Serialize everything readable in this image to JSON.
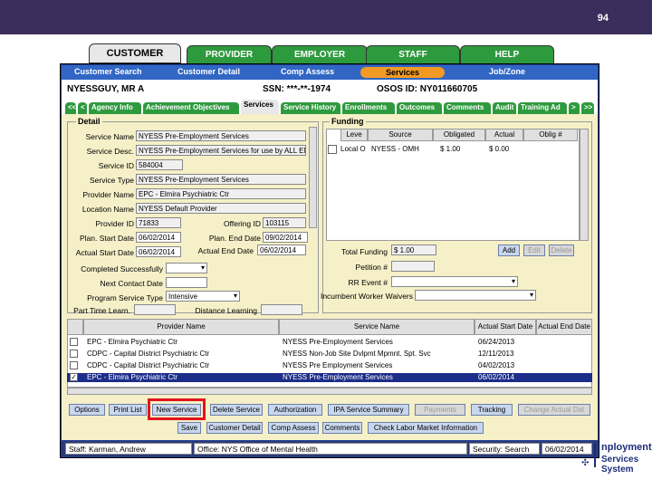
{
  "slide_number": "94",
  "main_tabs": [
    "CUSTOMER",
    "PROVIDER",
    "EMPLOYER",
    "STAFF",
    "HELP"
  ],
  "sub_nav": [
    "Customer Search",
    "Customer Detail",
    "Comp Assess",
    "Services",
    "Job/Zone"
  ],
  "customer": {
    "name": "NYESSGUY, MR  A",
    "ssn": "SSN: ***-**-1974",
    "osos_id": "OSOS ID: NY011660705"
  },
  "content_tabs": [
    "<<",
    "< ",
    "Agency Info",
    "Achievement Objectives",
    "Services",
    "Service History",
    "Enrollments",
    "Outcomes",
    "Comments",
    "Audit",
    "Training Ad",
    ">",
    ">>"
  ],
  "detail": {
    "section_title": "Detail",
    "labels": {
      "service_name": "Service Name",
      "service_desc": "Service Desc.",
      "service_id": "Service ID",
      "service_type": "Service Type",
      "provider_name": "Provider Name",
      "location_name": "Location Name",
      "provider_id": "Provider ID",
      "offering_id": "Offering ID",
      "plan_start": "Plan. Start Date",
      "plan_end": "Plan. End Date",
      "actual_start": "Actual Start Date",
      "actual_end": "Actual End Date",
      "completed": "Completed Successfully",
      "next_contact": "Next Contact Date",
      "program_type": "Program Service Type",
      "part_time": "Part Time Learn.",
      "distance": "Distance Learning"
    },
    "values": {
      "service_name": "NYESS Pre-Employment Services",
      "service_desc": "NYESS Pre-Employment Services for use by ALL EN",
      "service_id": "584004",
      "service_type": "NYESS Pre-Employment Services",
      "provider_name": "EPC - Elmira Psychiatric Ctr",
      "location_name": "NYESS Default Provider",
      "provider_id": "71833",
      "offering_id": "103115",
      "plan_start": "06/02/2014",
      "plan_end": "09/02/2014",
      "actual_start": "06/02/2014",
      "actual_end": "06/02/2014",
      "program_type": "Intensive"
    }
  },
  "funding": {
    "section_title": "Funding",
    "headers": [
      "Leve",
      "Source",
      "Obligated",
      "Actual",
      "Oblig #"
    ],
    "row": [
      "Local O",
      "NYESS - OMH",
      "$ 1.00",
      "$ 0.00",
      ""
    ],
    "labels": {
      "total": "Total Funding",
      "petition": "Petition #",
      "rr_event": "RR Event #",
      "incumbent": "Incumbent Worker Waivers"
    },
    "total_value": "$ 1.00",
    "buttons": [
      "Add",
      "Edit",
      "Delete"
    ]
  },
  "grid": {
    "headers": [
      "Provider Name",
      "Service Name",
      "Actual Start Date",
      "Actual End Date"
    ],
    "rows": [
      {
        "provider": "EPC - Elmira Psychiatric Ctr",
        "service": "NYESS Pre-Employment Services",
        "start": "06/24/2013",
        "end": "",
        "checked": true,
        "selected": false
      },
      {
        "provider": "CDPC - Capital District Psychiatric Ctr",
        "service": "NYESS Non-Job Site Dvlpmt Mpmnt. Spt. Svc",
        "start": "12/11/2013",
        "end": "",
        "checked": false,
        "selected": false
      },
      {
        "provider": "CDPC - Capital District Psychiatric Ctr",
        "service": "NYESS Pre Employment Services",
        "start": "04/02/2013",
        "end": "",
        "checked": false,
        "selected": false
      },
      {
        "provider": "EPC - Elmira Psychiatric Ctr",
        "service": "NYESS Pre-Employment Services",
        "start": "06/02/2014",
        "end": "",
        "checked": true,
        "selected": true
      }
    ]
  },
  "action_buttons": [
    "Options",
    "Print List",
    "New Service",
    "Delete Service",
    "Authorization",
    "IPA Service Summary",
    "Payments",
    "Tracking",
    "Change Actual Dat"
  ],
  "bottom_buttons": [
    "Save",
    "Customer Detail",
    "Comp Assess",
    "Comments",
    "Check Labor Market Information"
  ],
  "status": {
    "staff": "Staff: Karman, Andrew",
    "office": "Office: NYS Office of Mental Health",
    "security": "Security: Search",
    "date": "06/02/2014"
  },
  "logo_text": [
    "nployment",
    "Services System"
  ],
  "colors": {
    "header_bar": "#3b2e5c",
    "tab_green": "#2e9a3e",
    "nav_blue": "#3166c4",
    "selected_orange": "#f39a25",
    "highlight_red": "#e0141e"
  }
}
